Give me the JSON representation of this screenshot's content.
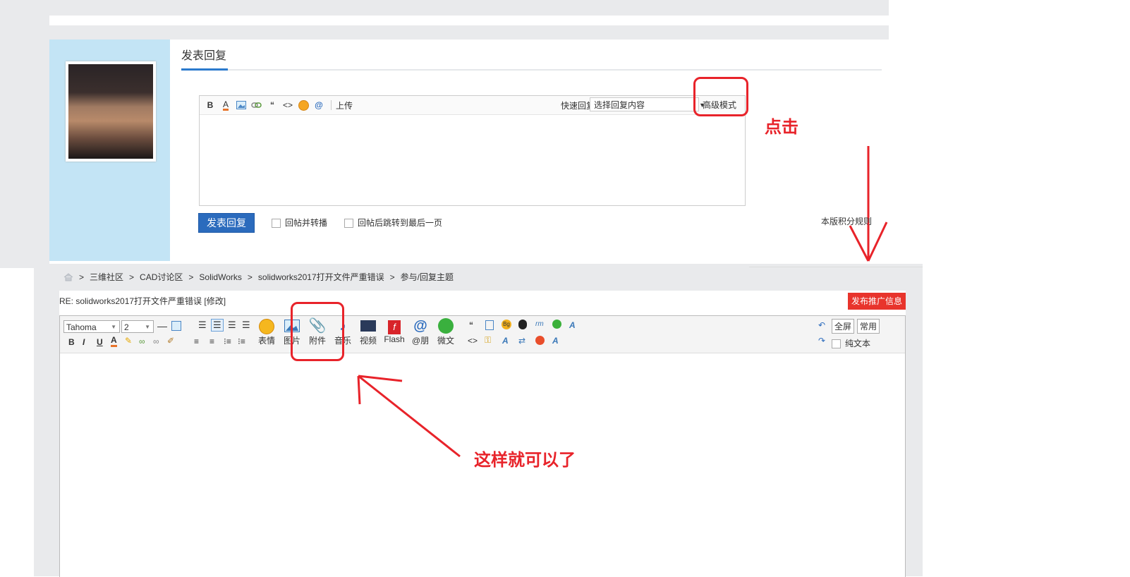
{
  "reply_section": {
    "title": "发表回复",
    "toolbar": {
      "bold": "B",
      "font_color": "A",
      "image": "image-icon",
      "link": "link-icon",
      "quote": "“",
      "code": "<>",
      "emoji": "emoji-icon",
      "at": "@",
      "upload": "上传"
    },
    "quick_reply_label": "快速回复",
    "quick_reply_select": "选择回复内容",
    "advanced_mode": "高级模式",
    "submit": "发表回复",
    "option_forward": "回帖并转播",
    "option_jump": "回帖后跳转到最后一页",
    "points_rules": "本版积分规则"
  },
  "annotations": {
    "click_hint": "点击",
    "result_hint": "这样就可以了"
  },
  "breadcrumb": {
    "items": [
      "三维社区",
      "CAD讨论区",
      "SolidWorks",
      "solidworks2017打开文件严重错误",
      "参与/回复主题"
    ],
    "separator": ">"
  },
  "advanced_editor": {
    "post_title": "RE: solidworks2017打开文件严重错误 [修改]",
    "promo_button": "发布推广信息",
    "font_family": "Tahoma",
    "font_size": "2",
    "row2_buttons": {
      "bold": "B",
      "italic": "I",
      "underline": "U",
      "color": "A"
    },
    "insert_buttons": [
      {
        "icon": "emoji-icon",
        "label": "表情"
      },
      {
        "icon": "image-icon",
        "label": "图片"
      },
      {
        "icon": "attachment-icon",
        "label": "附件"
      },
      {
        "icon": "music-icon",
        "label": "音乐"
      },
      {
        "icon": "video-icon",
        "label": "视频"
      },
      {
        "icon": "flash-icon",
        "label": "Flash"
      },
      {
        "icon": "at-icon",
        "label": "@朋"
      },
      {
        "icon": "wechat-icon",
        "label": "微文"
      }
    ],
    "fullscreen": "全屏",
    "common": "常用",
    "plain_text": "纯文本"
  },
  "colors": {
    "accent_blue": "#2b6bbd",
    "annotation_red": "#e8232a",
    "avatar_bg": "#c3e4f5",
    "promo_red": "#e8342c"
  }
}
